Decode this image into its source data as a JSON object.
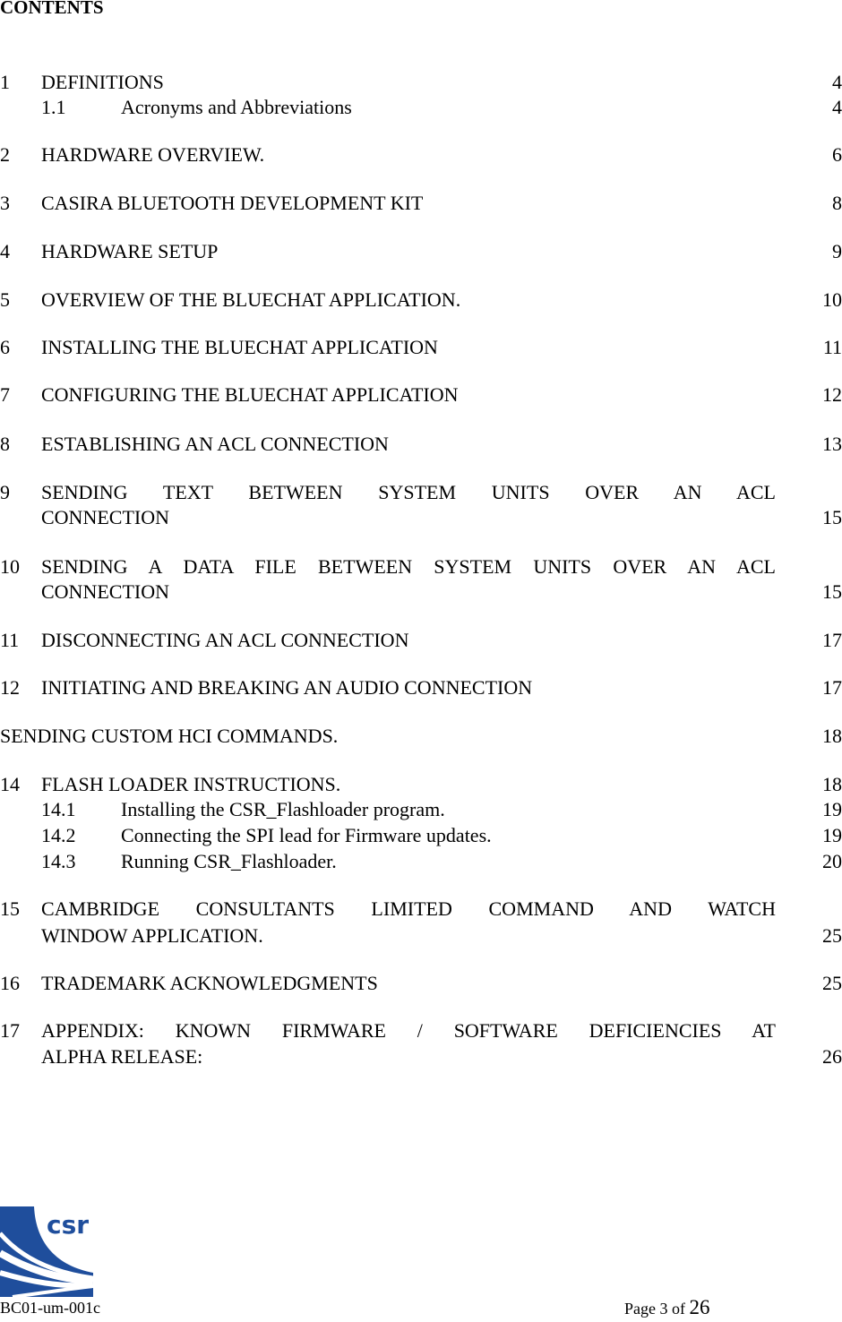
{
  "heading": "CONTENTS",
  "toc": {
    "s1": {
      "num": "1",
      "title": "DEFINITIONS",
      "page": "4"
    },
    "s1_1": {
      "num": "1.1",
      "title": "Acronyms and Abbreviations",
      "page": "4"
    },
    "s2": {
      "num": "2",
      "title": "HARDWARE OVERVIEW.",
      "page": "6"
    },
    "s3": {
      "num": "3",
      "title": "CASIRA BLUETOOTH DEVELOPMENT KIT",
      "page": "8"
    },
    "s4": {
      "num": "4",
      "title": "HARDWARE SETUP",
      "page": "9"
    },
    "s5": {
      "num": "5",
      "title": "OVERVIEW OF THE BLUECHAT APPLICATION.",
      "page": "10"
    },
    "s6": {
      "num": "6",
      "title": "INSTALLING THE BLUECHAT APPLICATION",
      "page": "11"
    },
    "s7": {
      "num": "7",
      "title": "CONFIGURING THE BLUECHAT APPLICATION",
      "page": "12"
    },
    "s8": {
      "num": "8",
      "title": "ESTABLISHING AN ACL CONNECTION",
      "page": "13"
    },
    "s9": {
      "num": "9",
      "title_line1": "SENDING TEXT BETWEEN SYSTEM UNITS OVER AN ACL",
      "title_line2": "CONNECTION",
      "page": "15"
    },
    "s10": {
      "num": "10",
      "title_line1": "SENDING A DATA FILE BETWEEN SYSTEM UNITS OVER AN ACL",
      "title_line2": "CONNECTION",
      "page": "15"
    },
    "s11": {
      "num": "11",
      "title": "DISCONNECTING AN ACL CONNECTION",
      "page": "17"
    },
    "s12": {
      "num": "12",
      "title": "INITIATING AND BREAKING AN AUDIO CONNECTION",
      "page": "17"
    },
    "s13": {
      "title": "SENDING CUSTOM HCI COMMANDS.",
      "page": "18"
    },
    "s14": {
      "num": "14",
      "title": "FLASH LOADER INSTRUCTIONS.",
      "page": "18"
    },
    "s14_1": {
      "num": "14.1",
      "title": "Installing the CSR_Flashloader program.",
      "page": "19"
    },
    "s14_2": {
      "num": "14.2",
      "title": "Connecting the SPI lead for Firmware updates.",
      "page": "19"
    },
    "s14_3": {
      "num": "14.3",
      "title": "Running CSR_Flashloader.",
      "page": "20"
    },
    "s15": {
      "num": "15",
      "title_line1": "CAMBRIDGE CONSULTANTS LIMITED COMMAND AND WATCH",
      "title_line2": "WINDOW APPLICATION.",
      "page": "25"
    },
    "s16": {
      "num": "16",
      "title": "TRADEMARK ACKNOWLEDGMENTS",
      "page": "25"
    },
    "s17": {
      "num": "17",
      "title_line1": "APPENDIX: KNOWN FIRMWARE / SOFTWARE DEFICIENCIES AT",
      "title_line2": "ALPHA RELEASE:",
      "page": "26"
    }
  },
  "footer": {
    "logo_text": "csr",
    "doc_id": "BC01-um-001c",
    "page_prefix": "Page 3 of ",
    "page_total": "26"
  },
  "colors": {
    "logo_blue": "#1f4e9c"
  }
}
